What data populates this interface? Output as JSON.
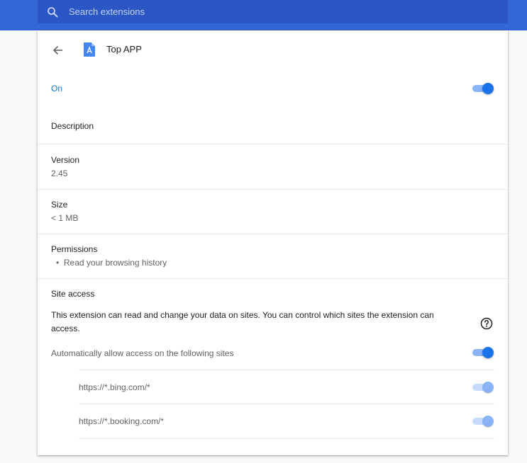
{
  "search": {
    "placeholder": "Search extensions",
    "icon": "search-icon"
  },
  "header": {
    "back_icon": "arrow-back-icon",
    "app_icon": "app-store-icon",
    "title": "Top APP"
  },
  "status": {
    "label": "On",
    "enabled": true
  },
  "description": {
    "title": "Description"
  },
  "version": {
    "title": "Version",
    "value": "2.45"
  },
  "size": {
    "title": "Size",
    "value": "< 1 MB"
  },
  "permissions": {
    "title": "Permissions",
    "items": [
      "Read your browsing history"
    ]
  },
  "site_access": {
    "title": "Site access",
    "text": "This extension can read and change your data on sites. You can control which sites the extension can access.",
    "help_icon": "help-circle-icon",
    "auto_label": "Automatically allow access on the following sites",
    "auto_enabled": true,
    "sites": [
      {
        "url": "https://*.bing.com/*",
        "enabled": true
      },
      {
        "url": "https://*.booking.com/*",
        "enabled": true
      }
    ]
  },
  "colors": {
    "topbar": "#3367d6",
    "search_bg": "#2a56c6",
    "accent": "#1a73e8",
    "toggle_track": "#8ab4f8"
  }
}
